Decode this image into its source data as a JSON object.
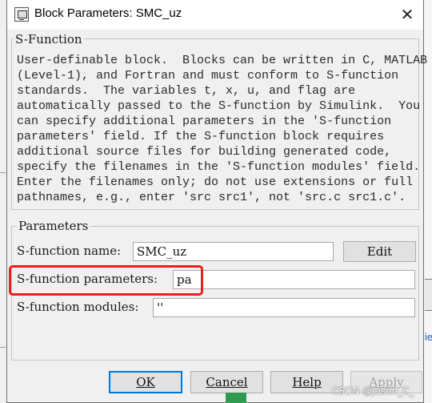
{
  "window": {
    "title": "Block Parameters: SMC_uz",
    "close_glyph": "✕"
  },
  "sfunction_group": {
    "title": "S-Function",
    "description_lines": [
      "User-definable block.  Blocks can be written in C, MATLAB",
      "(Level-1), and Fortran and must conform to S-function",
      "standards.  The variables t, x, u, and flag are",
      "automatically passed to the S-function by Simulink.  You",
      "can specify additional parameters in the 'S-function",
      "parameters' field. If the S-function block requires",
      "additional source files for building generated code,",
      "specify the filenames in the 'S-function modules' field.",
      "Enter the filenames only; do not use extensions or full",
      "pathnames, e.g., enter 'src src1', not 'src.c src1.c'."
    ]
  },
  "parameters_group": {
    "title": "Parameters",
    "name_label": "S-function name:",
    "name_value": "SMC_uz",
    "edit_label": "Edit",
    "params_label": "S-function parameters:",
    "params_value": "pa",
    "modules_label": "S-function modules:",
    "modules_value": "''"
  },
  "buttons": {
    "ok": "OK",
    "cancel": "Cancel",
    "help": "Help",
    "apply": "Apply"
  },
  "highlight": {
    "color": "#e8201f"
  },
  "watermark": "CSDN @Jason_C_"
}
